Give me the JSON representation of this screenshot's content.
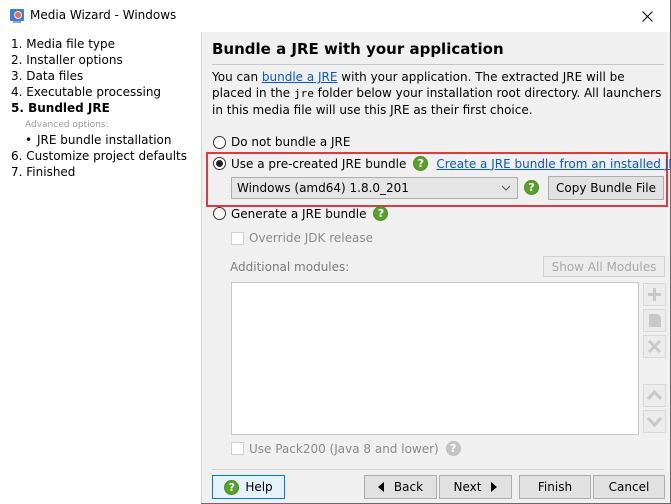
{
  "window": {
    "title": "Media Wizard - Windows",
    "close_icon": "close-icon"
  },
  "sidebar": {
    "steps": [
      {
        "label": "1. Media file type"
      },
      {
        "label": "2. Installer options"
      },
      {
        "label": "3. Data files"
      },
      {
        "label": "4. Executable processing"
      },
      {
        "label": "5. Bundled JRE",
        "active": true
      },
      {
        "label": "6. Customize project defaults"
      },
      {
        "label": "7. Finished"
      }
    ],
    "advanced_label": "Advanced options:",
    "sub_items": [
      {
        "bullet": "•",
        "label": "JRE bundle installation"
      }
    ]
  },
  "panel": {
    "heading": "Bundle a JRE with your application",
    "desc": {
      "part1": "You can ",
      "link": "bundle a JRE",
      "part2": " with your application. The extracted JRE will be placed in the ",
      "code": "jre",
      "part3": " folder below your installation root directory. All launchers in this media file will use this JRE as their first choice."
    },
    "options": {
      "no_bundle": {
        "label": "Do not bundle a JRE",
        "checked": false
      },
      "precreated": {
        "label": "Use a pre-created JRE bundle",
        "checked": true,
        "link": "Create a JRE bundle from an installed JRE or JDK",
        "combo_value": "Windows (amd64) 1.8.0_201",
        "copy_button": "Copy Bundle File"
      },
      "generate": {
        "label": "Generate a JRE bundle",
        "checked": false
      }
    },
    "generate_section": {
      "override_label": "Override JDK release",
      "override_checked": false,
      "modules_label": "Additional modules:",
      "show_all_button": "Show All Modules",
      "modules": [],
      "side_buttons": [
        "add-icon",
        "paste-icon",
        "remove-icon",
        "move-up-icon",
        "move-down-icon"
      ],
      "pack200_label": "Use Pack200 (Java 8 and lower)",
      "pack200_checked": false
    },
    "help_glyph": "?"
  },
  "footer": {
    "help": "Help",
    "back": "Back",
    "next": "Next",
    "finish": "Finish",
    "cancel": "Cancel"
  },
  "colors": {
    "highlight_border": "#e0393e",
    "link": "#0b57c4",
    "help_green": "#5aa02c",
    "panel_bg": "#f0f0f0"
  }
}
